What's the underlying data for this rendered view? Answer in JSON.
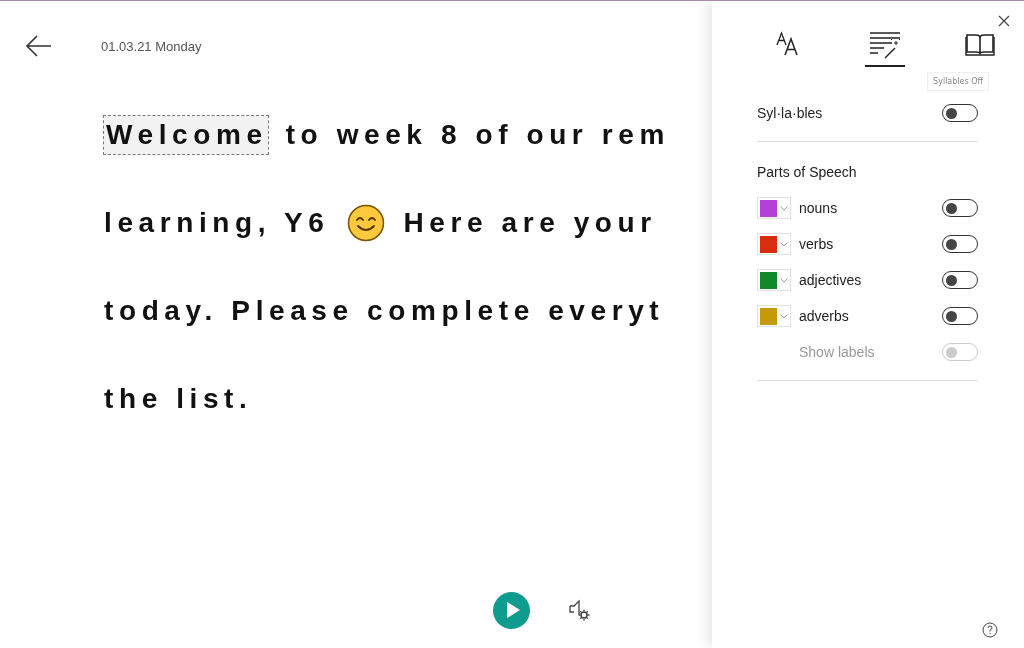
{
  "header": {
    "date": "01.03.21 Monday"
  },
  "reading": {
    "lines": [
      {
        "parts": [
          {
            "kind": "focus",
            "text": "Welcome"
          },
          {
            "kind": "text",
            "text": "to week 8 of our rem"
          }
        ]
      },
      {
        "parts": [
          {
            "kind": "text",
            "text": "learning, Y6"
          },
          {
            "kind": "emoji"
          },
          {
            "kind": "text",
            "text": "Here are your"
          }
        ]
      },
      {
        "parts": [
          {
            "kind": "text",
            "text": "today. Please complete everyt"
          }
        ]
      },
      {
        "parts": [
          {
            "kind": "text",
            "text": "the list."
          }
        ]
      }
    ]
  },
  "panel": {
    "tabs": [
      {
        "kind": "text-options",
        "selected": false
      },
      {
        "kind": "grammar",
        "selected": true
      },
      {
        "kind": "reading",
        "selected": false
      }
    ],
    "tooltip": "Syllables Off",
    "syllables": {
      "label": "Syl·la·bles",
      "on": false
    },
    "parts_heading": "Parts of Speech",
    "parts": [
      {
        "label": "nouns",
        "color": "#b23fd6",
        "on": false
      },
      {
        "label": "verbs",
        "color": "#d92d10",
        "on": false
      },
      {
        "label": "adjectives",
        "color": "#13882b",
        "on": false
      },
      {
        "label": "adverbs",
        "color": "#c49a06",
        "on": false
      }
    ],
    "show_labels": {
      "label": "Show labels",
      "on": false,
      "disabled": true
    }
  }
}
